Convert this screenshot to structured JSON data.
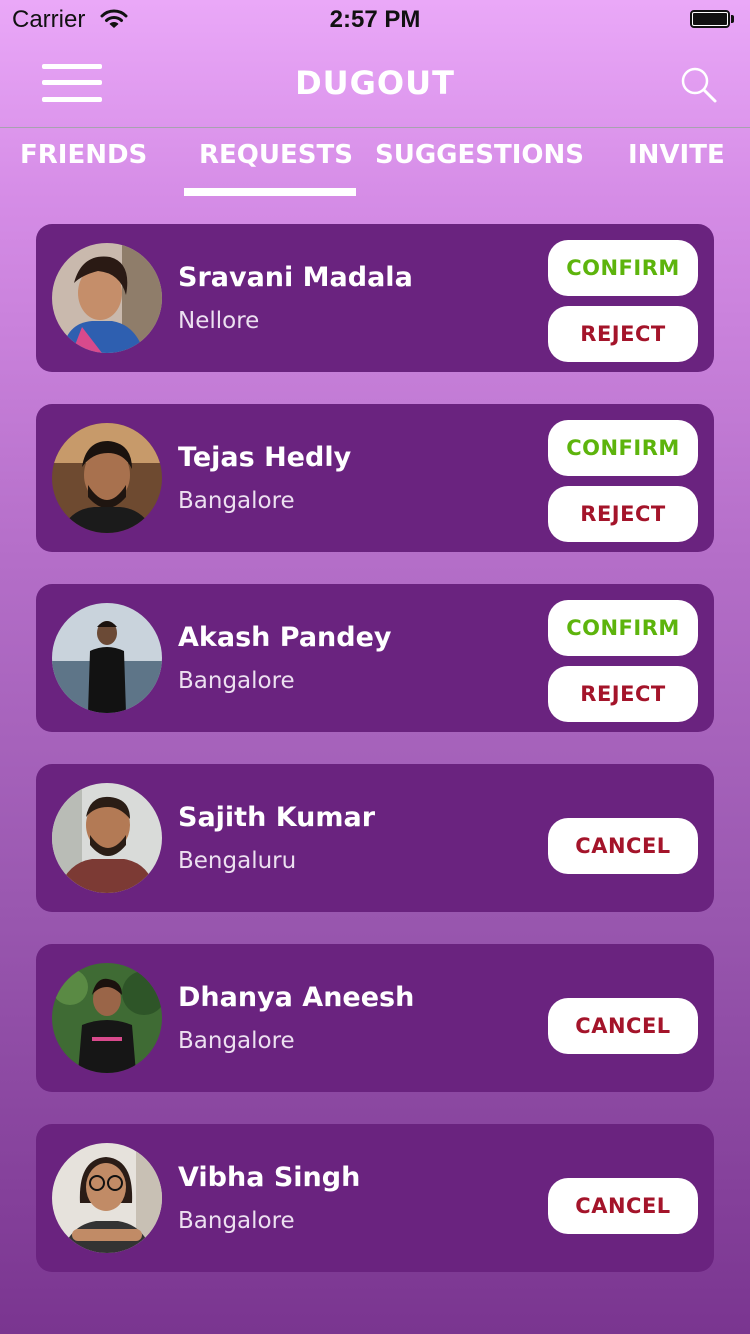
{
  "status_bar": {
    "carrier": "Carrier",
    "time": "2:57 PM"
  },
  "header": {
    "title": "DUGOUT",
    "menu_icon": "hamburger-menu-icon",
    "search_icon": "search-icon"
  },
  "tabs": [
    {
      "label": "FRIENDS",
      "active": false
    },
    {
      "label": "REQUESTS",
      "active": true
    },
    {
      "label": "SUGGESTIONS",
      "active": false
    },
    {
      "label": "INVITE",
      "active": false
    }
  ],
  "requests": [
    {
      "name": "Sravani Madala",
      "city": "Nellore",
      "actions": [
        "CONFIRM",
        "REJECT"
      ]
    },
    {
      "name": "Tejas Hedly",
      "city": "Bangalore",
      "actions": [
        "CONFIRM",
        "REJECT"
      ]
    },
    {
      "name": "Akash Pandey",
      "city": "Bangalore",
      "actions": [
        "CONFIRM",
        "REJECT"
      ]
    },
    {
      "name": "Sajith Kumar",
      "city": "Bengaluru",
      "actions": [
        "CANCEL"
      ]
    },
    {
      "name": "Dhanya Aneesh",
      "city": "Bangalore",
      "actions": [
        "CANCEL"
      ]
    },
    {
      "name": "Vibha Singh",
      "city": "Bangalore",
      "actions": [
        "CANCEL"
      ]
    }
  ],
  "colors": {
    "card_background": "#6a237f",
    "confirm_text": "#5db40c",
    "reject_text": "#a4142a",
    "cancel_text": "#a4142a"
  }
}
